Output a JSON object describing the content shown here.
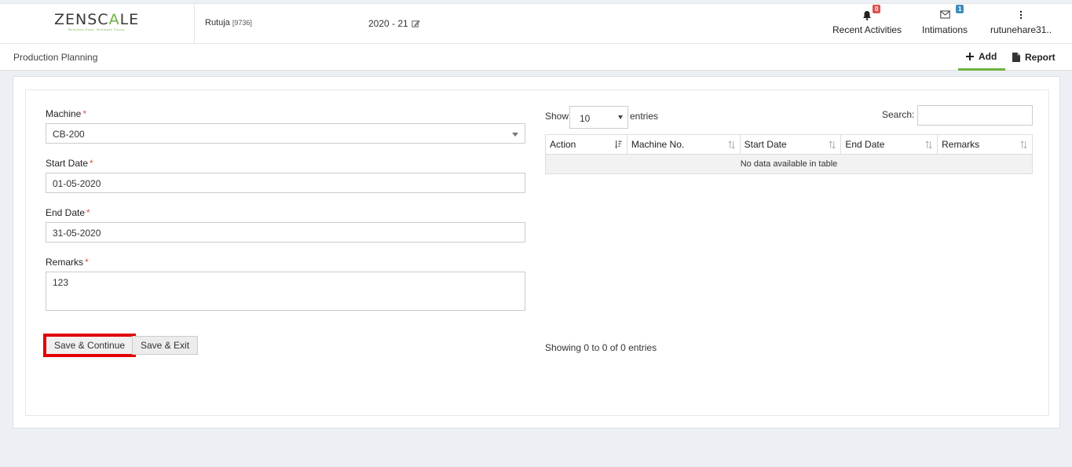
{
  "header": {
    "logo_left": "ZENSC",
    "logo_accent": "A",
    "logo_right": "LE",
    "logo_tagline": "Business Ease. Business Focus.",
    "user_name": "Rutuja",
    "user_code": "[9736]",
    "fiscal_year": "2020 - 21",
    "recent_activities": {
      "label": "Recent Activities",
      "count": "0"
    },
    "intimations": {
      "label": "Intimations",
      "count": "1"
    },
    "user_menu": {
      "label": "rutunehare31.."
    }
  },
  "subheader": {
    "page_title": "Production Planning",
    "add_tab": "Add",
    "report_tab": "Report"
  },
  "form": {
    "machine_label": "Machine",
    "machine_value": "CB-200",
    "start_date_label": "Start Date",
    "start_date_value": "01-05-2020",
    "end_date_label": "End Date",
    "end_date_value": "31-05-2020",
    "remarks_label": "Remarks",
    "remarks_value": "123",
    "required_mark": "*",
    "save_continue": "Save & Continue",
    "save_exit": "Save & Exit"
  },
  "table": {
    "show_label": "Show",
    "entries_value": "10",
    "entries_label": "entries",
    "search_label": "Search:",
    "columns": [
      "Action",
      "Machine No.",
      "Start Date",
      "End Date",
      "Remarks"
    ],
    "empty_message": "No data available in table",
    "info": "Showing 0 to 0 of 0 entries"
  },
  "colors": {
    "accent_green": "#6cb33f",
    "required_red": "#d9534f",
    "highlight_red": "#e50000"
  }
}
